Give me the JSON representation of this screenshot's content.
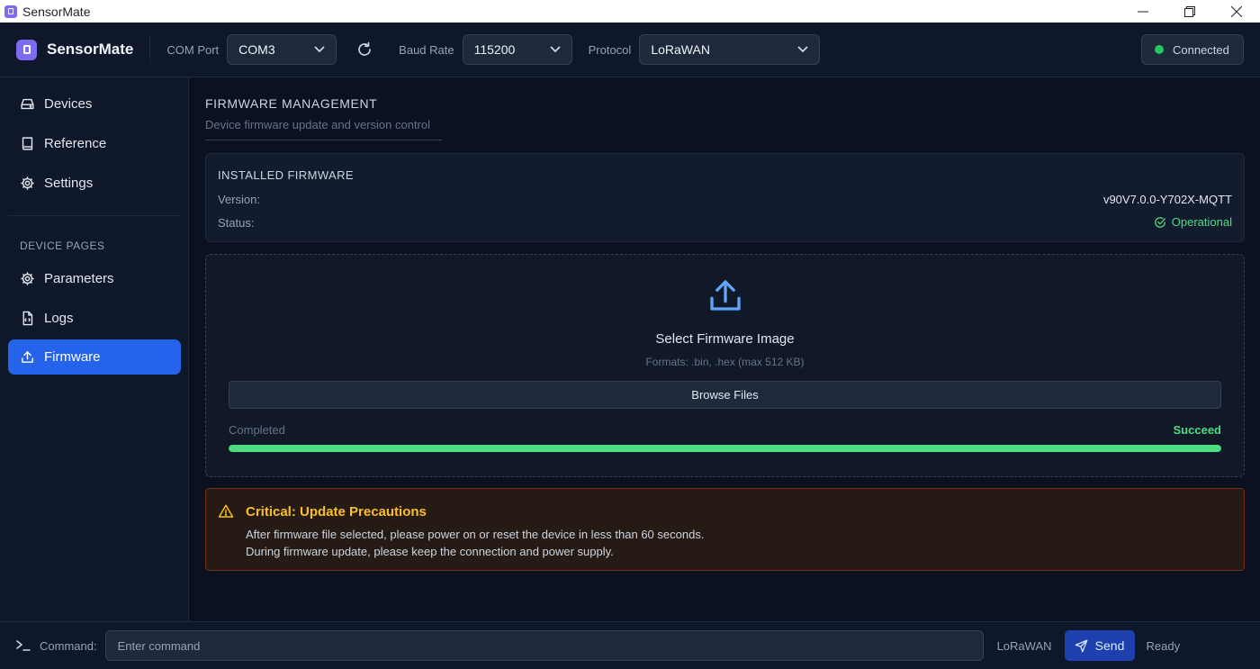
{
  "window": {
    "title": "SensorMate"
  },
  "toolbar": {
    "brand": "SensorMate",
    "com_port_label": "COM Port",
    "com_port_value": "COM3",
    "baud_rate_label": "Baud Rate",
    "baud_rate_value": "115200",
    "protocol_label": "Protocol",
    "protocol_value": "LoRaWAN",
    "connection_status": "Connected",
    "status_color": "#22c55e"
  },
  "sidebar": {
    "items": [
      {
        "label": "Devices",
        "icon": "drive-icon"
      },
      {
        "label": "Reference",
        "icon": "book-icon"
      },
      {
        "label": "Settings",
        "icon": "gear-icon"
      }
    ],
    "section_label": "DEVICE PAGES",
    "device_items": [
      {
        "label": "Parameters",
        "icon": "gear-icon"
      },
      {
        "label": "Logs",
        "icon": "log-file-icon"
      },
      {
        "label": "Firmware",
        "icon": "upload-icon",
        "active": true
      }
    ],
    "accent_color": "#2563eb"
  },
  "main": {
    "title": "FIRMWARE MANAGEMENT",
    "subtitle": "Device firmware update and version control",
    "installed": {
      "title": "INSTALLED FIRMWARE",
      "version_label": "Version:",
      "version_value": "v90V7.0.0-Y702X-MQTT",
      "status_label": "Status:",
      "status_value": "Operational"
    },
    "upload": {
      "title": "Select Firmware Image",
      "formats": "Formats: .bin, .hex (max 512 KB)",
      "browse_label": "Browse Files",
      "progress_label": "Completed",
      "progress_state": "Succeed",
      "progress_percent": 100
    },
    "warning": {
      "title": "Critical: Update Precautions",
      "line1": "After firmware file selected, please power on or reset the device in less than 60 seconds.",
      "line2": "During firmware update, please keep the connection and power supply."
    }
  },
  "command_bar": {
    "label": "Command:",
    "placeholder": "Enter command",
    "protocol": "LoRaWAN",
    "send_label": "Send",
    "status": "Ready"
  }
}
